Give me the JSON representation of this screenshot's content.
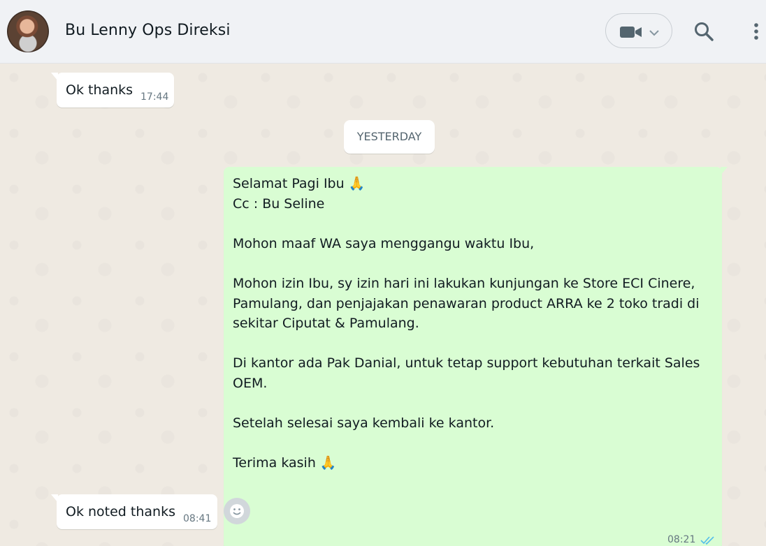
{
  "header": {
    "contact_name": "Bu Lenny Ops Direksi",
    "avatar": "profile-photo",
    "icons": [
      "video-call-icon",
      "chevron-down-icon",
      "search-icon",
      "menu-icon"
    ]
  },
  "chat": {
    "day_separator": "YESTERDAY",
    "messages": [
      {
        "direction": "incoming",
        "text": "Ok thanks",
        "time": "17:44"
      },
      {
        "direction": "outgoing",
        "text": "Selamat Pagi Ibu 🙏\nCc : Bu Seline\n\nMohon maaf WA saya menggangu waktu Ibu,\n\nMohon izin Ibu, sy izin hari ini lakukan kunjungan ke Store ECI Cinere,\nPamulang, dan penjajakan penawaran product ARRA ke 2 toko tradi di\nsekitar Ciputat & Pamulang.\n\nDi kantor ada Pak Danial, untuk tetap support kebutuhan terkait Sales\nOEM.\n\nSetelah selesai saya kembali ke kantor.\n\nTerima kasih 🙏",
        "time": "08:21",
        "status": "read"
      },
      {
        "direction": "incoming",
        "text": "Ok noted thanks",
        "time": "08:41"
      }
    ]
  },
  "colors": {
    "outgoing_bubble": "#d9fdd3",
    "incoming_bubble": "#ffffff",
    "read_ticks": "#53bdeb",
    "chat_background": "#efeae2"
  }
}
